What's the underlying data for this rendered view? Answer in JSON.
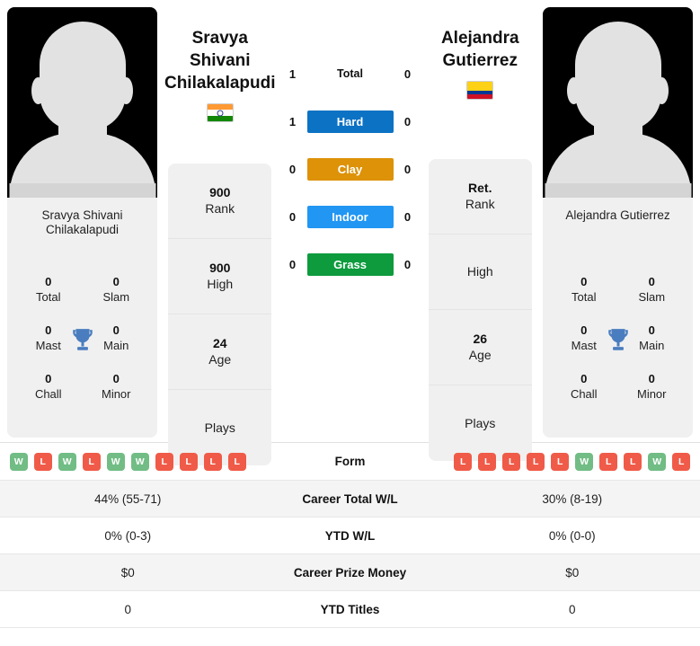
{
  "players": {
    "left": {
      "name": "Sravya Shivani Chilakalapudi",
      "card_name": "Sravya Shivani Chilakalapudi",
      "country": "India",
      "flag_icon": "flag-india-icon",
      "info": [
        {
          "value": "900",
          "label": "Rank"
        },
        {
          "value": "900",
          "label": "High"
        },
        {
          "value": "24",
          "label": "Age"
        },
        {
          "value": "",
          "label": "Plays"
        }
      ],
      "titles": [
        {
          "value": "0",
          "label": "Total"
        },
        {
          "value": "0",
          "label": "Slam"
        },
        {
          "value": "0",
          "label": "Mast"
        },
        {
          "value": "0",
          "label": "Main"
        },
        {
          "value": "0",
          "label": "Chall"
        },
        {
          "value": "0",
          "label": "Minor"
        }
      ],
      "form": [
        "W",
        "L",
        "W",
        "L",
        "W",
        "W",
        "L",
        "L",
        "L",
        "L"
      ]
    },
    "right": {
      "name": "Alejandra Gutierrez",
      "card_name": "Alejandra Gutierrez",
      "country": "Colombia",
      "flag_icon": "flag-colombia-icon",
      "info": [
        {
          "value": "Ret.",
          "label": "Rank"
        },
        {
          "value": "",
          "label": "High"
        },
        {
          "value": "26",
          "label": "Age"
        },
        {
          "value": "",
          "label": "Plays"
        }
      ],
      "titles": [
        {
          "value": "0",
          "label": "Total"
        },
        {
          "value": "0",
          "label": "Slam"
        },
        {
          "value": "0",
          "label": "Mast"
        },
        {
          "value": "0",
          "label": "Main"
        },
        {
          "value": "0",
          "label": "Chall"
        },
        {
          "value": "0",
          "label": "Minor"
        }
      ],
      "form": [
        "L",
        "L",
        "L",
        "L",
        "L",
        "W",
        "L",
        "L",
        "W",
        "L"
      ]
    }
  },
  "trophy_icon": "trophy-icon",
  "h2h": {
    "rows": [
      {
        "label": "Total",
        "left": "1",
        "right": "0",
        "color": ""
      },
      {
        "label": "Hard",
        "left": "1",
        "right": "0",
        "color": "#0c72c4"
      },
      {
        "label": "Clay",
        "left": "0",
        "right": "0",
        "color": "#dd9208"
      },
      {
        "label": "Indoor",
        "left": "0",
        "right": "0",
        "color": "#2196f3"
      },
      {
        "label": "Grass",
        "left": "0",
        "right": "0",
        "color": "#0d9b3d"
      }
    ]
  },
  "comparison": {
    "form_label": "Form",
    "rows": [
      {
        "label": "Career Total W/L",
        "left": "44% (55-71)",
        "right": "30% (8-19)"
      },
      {
        "label": "YTD W/L",
        "left": "0% (0-3)",
        "right": "0% (0-0)"
      },
      {
        "label": "Career Prize Money",
        "left": "$0",
        "right": "$0"
      },
      {
        "label": "YTD Titles",
        "left": "0",
        "right": "0"
      }
    ]
  }
}
